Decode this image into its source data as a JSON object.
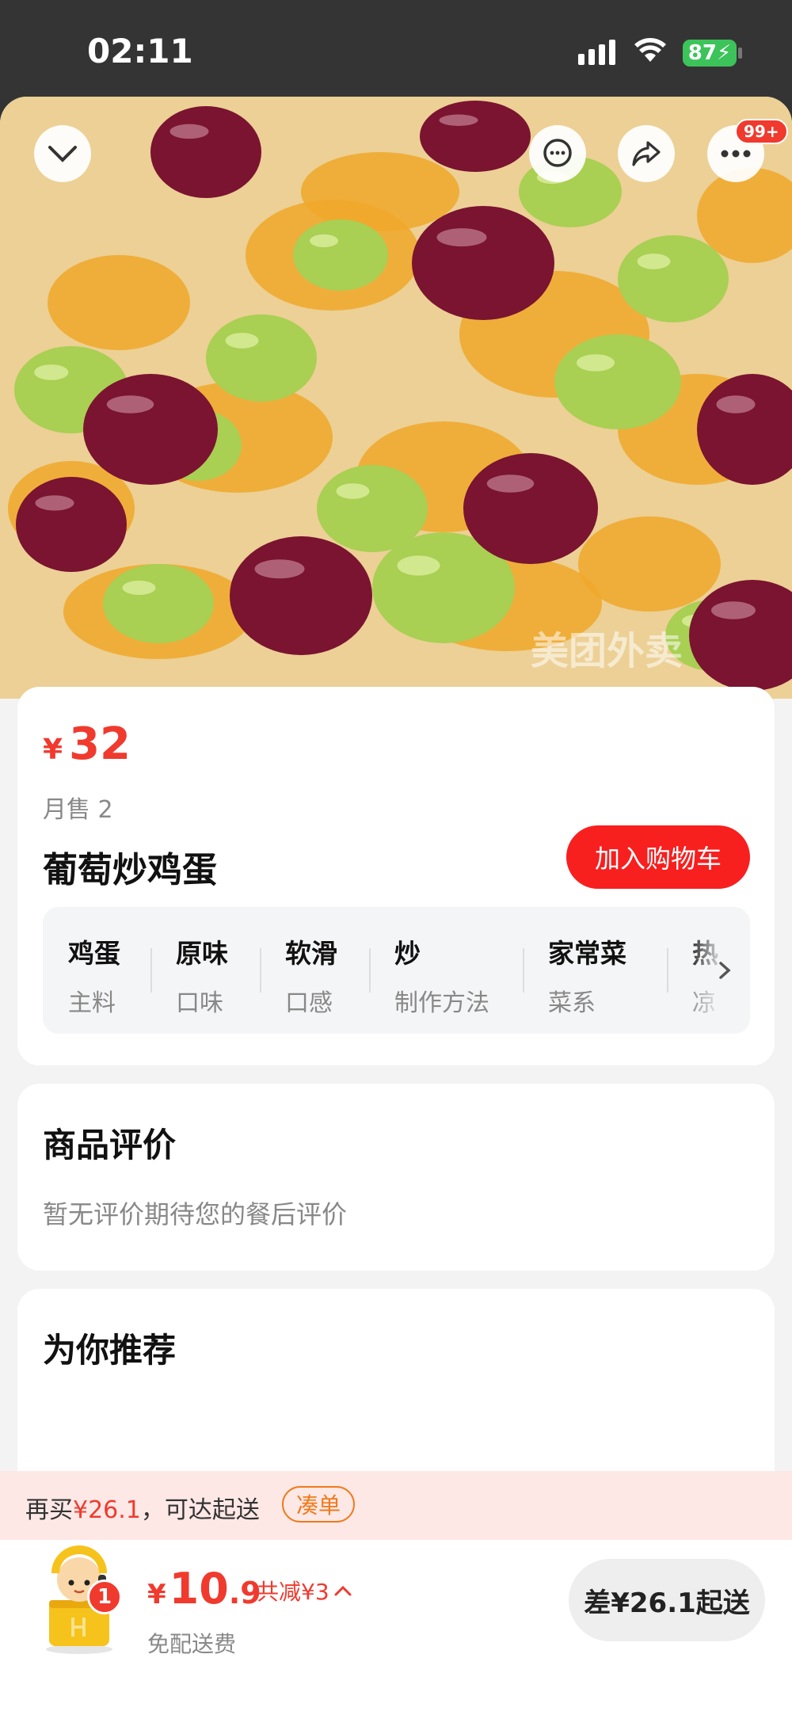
{
  "status_bar": {
    "time": "02:11",
    "battery": "87"
  },
  "hero": {
    "watermark": "美团外卖",
    "more_badge": "99+",
    "icons": [
      "chevron-down-icon",
      "chat-icon",
      "share-icon",
      "more-icon"
    ]
  },
  "product": {
    "currency": "¥",
    "price": "32",
    "monthly_sales": "月售 2",
    "name": "葡萄炒鸡蛋",
    "add_to_cart_label": "加入购物车",
    "attributes": [
      {
        "value": "鸡蛋",
        "key": "主料"
      },
      {
        "value": "原味",
        "key": "口味"
      },
      {
        "value": "软滑",
        "key": "口感"
      },
      {
        "value": "炒",
        "key": "制作方法"
      },
      {
        "value": "家常菜",
        "key": "菜系"
      },
      {
        "value": "热",
        "key": "凉"
      }
    ]
  },
  "reviews": {
    "title": "商品评价",
    "empty_text": "暂无评价期待您的餐后评价"
  },
  "recommendations": {
    "title": "为你推荐"
  },
  "banner": {
    "prefix": "再买",
    "amount": "¥26.1",
    "suffix": "，可达起送",
    "button_label": "凑单"
  },
  "cart": {
    "count": "1",
    "currency": "¥",
    "total_int": "10",
    "total_dec": ".9",
    "discount": "共减¥3",
    "delivery_fee": "免配送费",
    "checkout_label": "差¥26.1起送"
  },
  "colors": {
    "accent_red": "#f03a2e",
    "button_red": "#f81f1f",
    "orange": "#f07a1a",
    "banner_bg": "#fde8e6"
  }
}
